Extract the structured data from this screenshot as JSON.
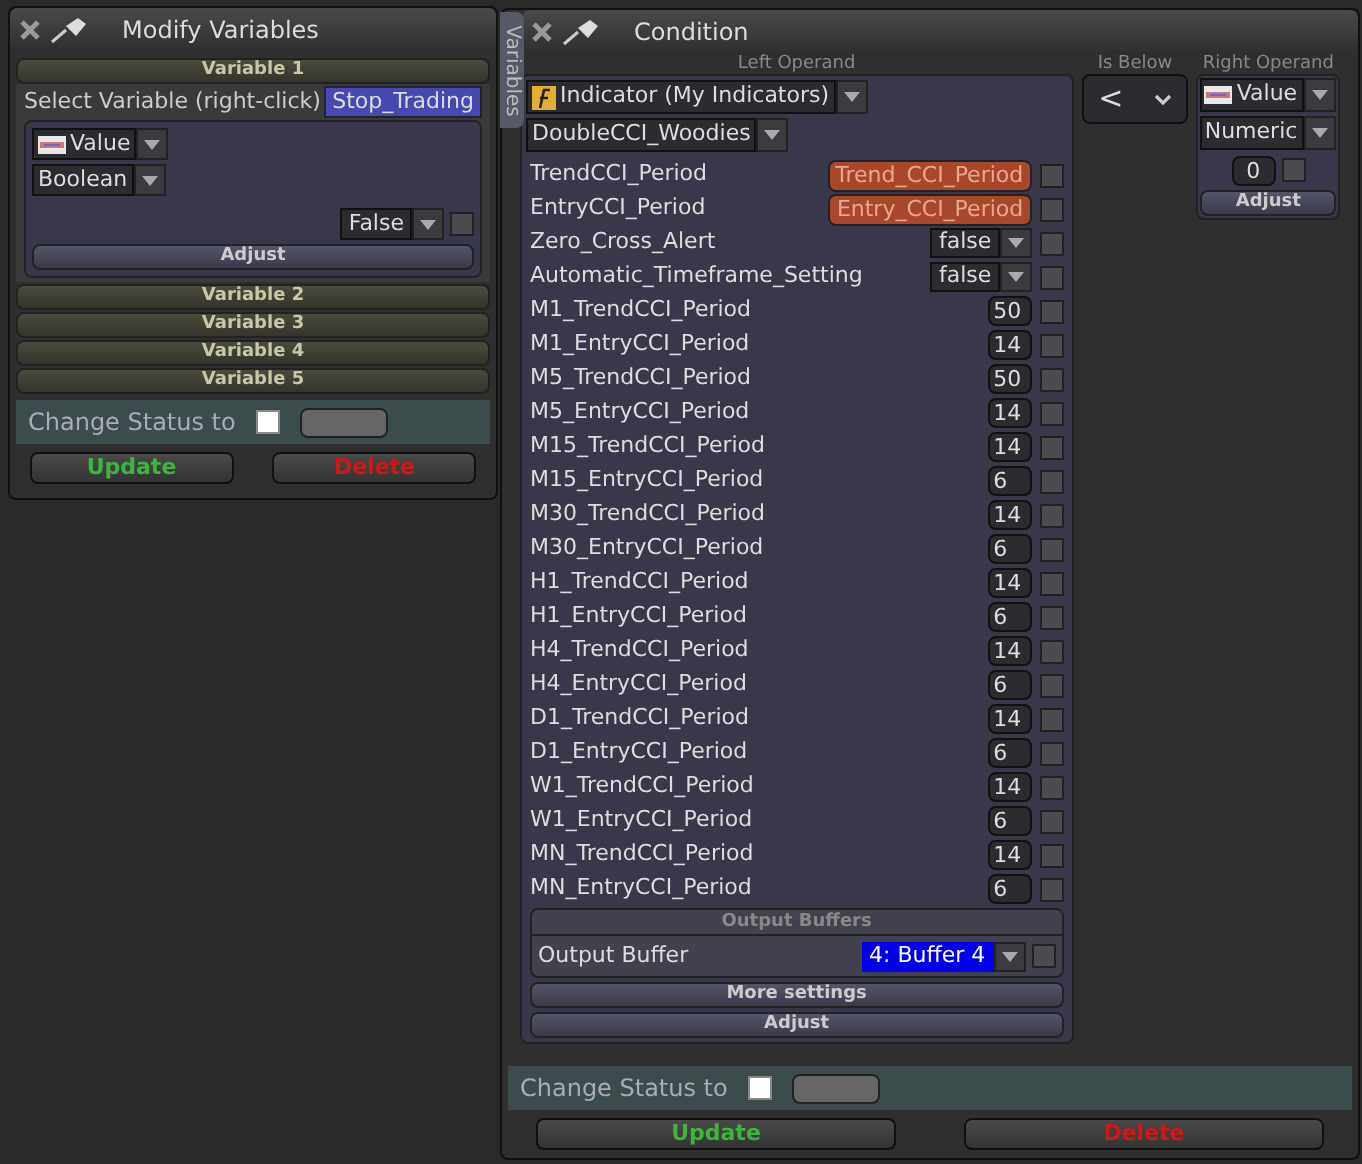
{
  "modify_window": {
    "title": "Modify Variables",
    "variables": [
      {
        "title": "Variable 1",
        "expanded": true,
        "select_label": "Select Variable (right-click)",
        "variable_name": "Stop_Trading",
        "source": "Value",
        "type": "Boolean",
        "value": "False",
        "checked": false,
        "adjust": "Adjust"
      },
      {
        "title": "Variable 2",
        "expanded": false
      },
      {
        "title": "Variable 3",
        "expanded": false
      },
      {
        "title": "Variable 4",
        "expanded": false
      },
      {
        "title": "Variable 5",
        "expanded": false
      }
    ],
    "status": {
      "label": "Change Status to",
      "checked": false
    },
    "buttons": [
      {
        "label": "Update",
        "kind": "update"
      },
      {
        "label": "Delete",
        "kind": "delete"
      }
    ]
  },
  "condition_window": {
    "title": "Condition",
    "side_tab": "Variables",
    "left_operand": {
      "heading": "Left Operand",
      "source": "Indicator (My Indicators)",
      "indicator": "DoubleCCI_Woodies",
      "params": [
        {
          "name": "TrendCCI_Period",
          "kind": "variable",
          "value": "Trend_CCI_Period",
          "checked": false
        },
        {
          "name": "EntryCCI_Period",
          "kind": "variable",
          "value": "Entry_CCI_Period",
          "checked": false
        },
        {
          "name": "Zero_Cross_Alert",
          "kind": "dropdown",
          "value": "false",
          "checked": false
        },
        {
          "name": "Automatic_Timeframe_Setting",
          "kind": "dropdown",
          "value": "false",
          "checked": false
        },
        {
          "name": "M1_TrendCCI_Period",
          "kind": "number",
          "value": "50",
          "checked": false
        },
        {
          "name": "M1_EntryCCI_Period",
          "kind": "number",
          "value": "14",
          "checked": false
        },
        {
          "name": "M5_TrendCCI_Period",
          "kind": "number",
          "value": "50",
          "checked": false
        },
        {
          "name": "M5_EntryCCI_Period",
          "kind": "number",
          "value": "14",
          "checked": false
        },
        {
          "name": "M15_TrendCCI_Period",
          "kind": "number",
          "value": "14",
          "checked": false
        },
        {
          "name": "M15_EntryCCI_Period",
          "kind": "number",
          "value": "6",
          "checked": false
        },
        {
          "name": "M30_TrendCCI_Period",
          "kind": "number",
          "value": "14",
          "checked": false
        },
        {
          "name": "M30_EntryCCI_Period",
          "kind": "number",
          "value": "6",
          "checked": false
        },
        {
          "name": "H1_TrendCCI_Period",
          "kind": "number",
          "value": "14",
          "checked": false
        },
        {
          "name": "H1_EntryCCI_Period",
          "kind": "number",
          "value": "6",
          "checked": false
        },
        {
          "name": "H4_TrendCCI_Period",
          "kind": "number",
          "value": "14",
          "checked": false
        },
        {
          "name": "H4_EntryCCI_Period",
          "kind": "number",
          "value": "6",
          "checked": false
        },
        {
          "name": "D1_TrendCCI_Period",
          "kind": "number",
          "value": "14",
          "checked": false
        },
        {
          "name": "D1_EntryCCI_Period",
          "kind": "number",
          "value": "6",
          "checked": false
        },
        {
          "name": "W1_TrendCCI_Period",
          "kind": "number",
          "value": "14",
          "checked": false
        },
        {
          "name": "W1_EntryCCI_Period",
          "kind": "number",
          "value": "6",
          "checked": false
        },
        {
          "name": "MN_TrendCCI_Period",
          "kind": "number",
          "value": "14",
          "checked": false
        },
        {
          "name": "MN_EntryCCI_Period",
          "kind": "number",
          "value": "6",
          "checked": false
        }
      ],
      "output_buffers": {
        "heading": "Output Buffers",
        "label": "Output Buffer",
        "value": "4: Buffer 4",
        "checked": false
      },
      "more_settings": "More settings",
      "adjust": "Adjust"
    },
    "operator": {
      "heading": "Is Below",
      "value": "<"
    },
    "right_operand": {
      "heading": "Right Operand",
      "source": "Value",
      "type": "Numeric",
      "value": "0",
      "checked": false,
      "adjust": "Adjust"
    },
    "status": {
      "label": "Change Status to",
      "checked": false
    },
    "buttons": [
      {
        "label": "Update",
        "kind": "update"
      },
      {
        "label": "Delete",
        "kind": "delete"
      }
    ]
  }
}
